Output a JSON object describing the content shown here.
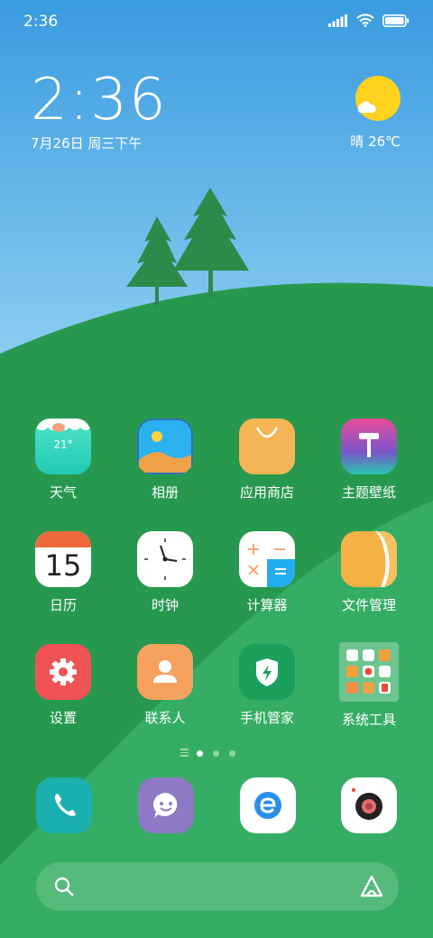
{
  "status_bar": {
    "time": "2:36"
  },
  "clock_widget": {
    "time": "2:36",
    "date": "7月26日 周三下午"
  },
  "weather_widget": {
    "text": "晴 26℃",
    "icon": "sunny-cloud-icon",
    "sun_color": "#ffd21f"
  },
  "apps": [
    {
      "label": "天气",
      "icon": "weather-icon",
      "badge": "21°"
    },
    {
      "label": "相册",
      "icon": "gallery-icon"
    },
    {
      "label": "应用商店",
      "icon": "app-store-icon"
    },
    {
      "label": "主题壁纸",
      "icon": "themes-icon"
    },
    {
      "label": "日历",
      "icon": "calendar-icon",
      "badge": "15"
    },
    {
      "label": "时钟",
      "icon": "clock-icon"
    },
    {
      "label": "计算器",
      "icon": "calculator-icon"
    },
    {
      "label": "文件管理",
      "icon": "file-manager-icon"
    },
    {
      "label": "设置",
      "icon": "settings-icon"
    },
    {
      "label": "联系人",
      "icon": "contacts-icon"
    },
    {
      "label": "手机管家",
      "icon": "security-icon"
    },
    {
      "label": "系统工具",
      "icon": "system-tools-folder-icon"
    }
  ],
  "dock": [
    {
      "icon": "phone-icon",
      "color": "#1bb0b0"
    },
    {
      "icon": "messages-icon",
      "color": "#8e79c6"
    },
    {
      "icon": "browser-icon",
      "color": "#ffffff"
    },
    {
      "icon": "camera-icon",
      "color": "#ffffff"
    }
  ],
  "page_indicator": {
    "pages": 3,
    "active": 1
  },
  "search_bar": {
    "icon": "search-icon",
    "assistant_icon": "assistant-icon"
  },
  "colors": {
    "sky_top": "#3a9be0",
    "hill_dark": "#27994f",
    "hill_light": "#35ad64",
    "tree": "#2d8a4a"
  }
}
